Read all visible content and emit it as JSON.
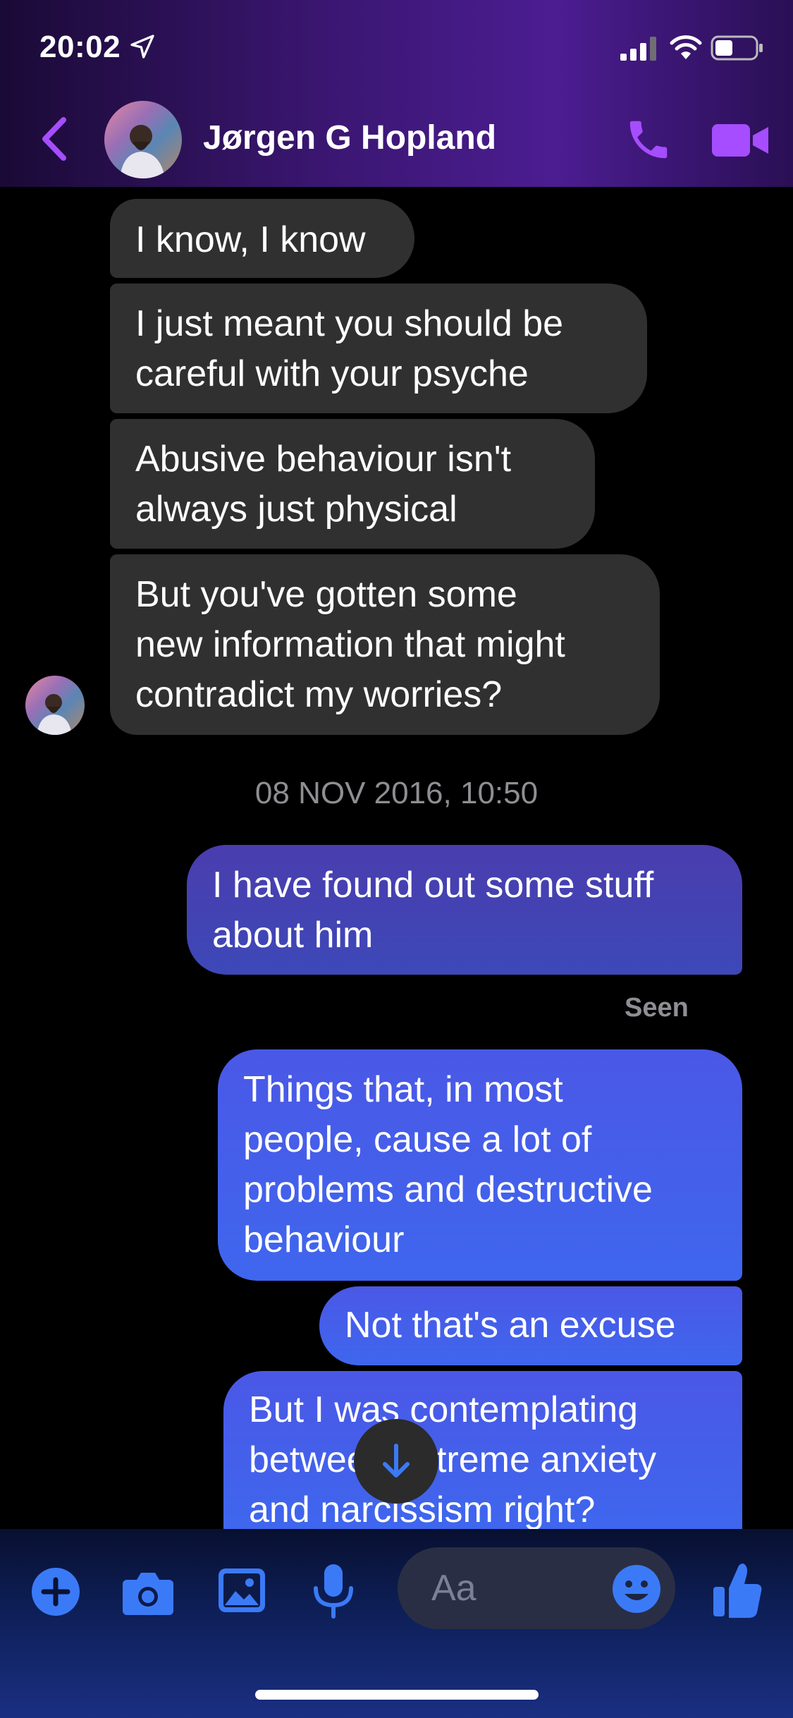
{
  "status_bar": {
    "time": "20:02"
  },
  "header": {
    "contact_name": "Jørgen G Hopland"
  },
  "messages_incoming": [
    "I know, I know",
    "I just meant you should be\ncareful with your psyche",
    "Abusive behaviour isn't\nalways just physical",
    "But you've gotten some\nnew information that might\ncontradict my worries?"
  ],
  "timestamp": "08 NOV 2016, 10:50",
  "messages_outgoing": [
    "I have found out some stuff\nabout him",
    "Things that, in most\npeople, cause a lot of\nproblems and destructive\nbehaviour",
    "Not that's an excuse",
    "But I was contemplating\nbetween extreme anxiety\nand narcissism right?"
  ],
  "seen_label": "Seen",
  "composer": {
    "placeholder": "Aa"
  },
  "icons": [
    "location-arrow-icon",
    "signal-icon",
    "wifi-icon",
    "battery-icon",
    "back-chevron-icon",
    "phone-icon",
    "video-camera-icon",
    "arrow-down-icon",
    "plus-icon",
    "camera-icon",
    "image-icon",
    "microphone-icon",
    "emoji-icon",
    "thumbs-up-icon"
  ],
  "colors": {
    "accent_purple": "#a64dff",
    "composer_blue": "#3b7af7",
    "incoming_bubble": "#303030",
    "outgoing_bubble": "#4a58e6"
  }
}
